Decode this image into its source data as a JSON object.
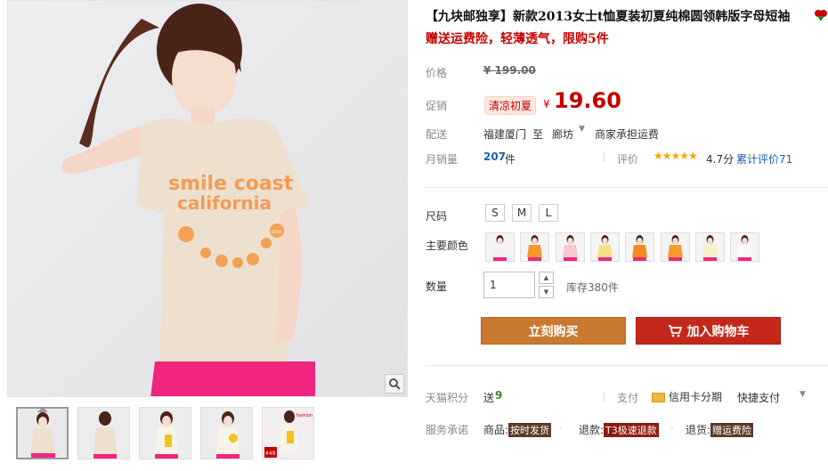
{
  "product": {
    "title": "【九块邮独享】新款2013女士t恤夏装初夏纯棉圆领韩版字母短袖",
    "subtitle": "赠送运费险，轻薄透气，限购5件",
    "shirt_text_1": "smile coast",
    "shirt_text_2": "california",
    "shirt_badge": "one"
  },
  "price": {
    "label": "价格",
    "original": "¥ 199.00"
  },
  "promo": {
    "label": "促销",
    "badge": "清凉初夏",
    "symbol": "¥",
    "price": "19.60"
  },
  "delivery": {
    "label": "配送",
    "from": "福建厦门",
    "to_word": "至",
    "to": "廊坊",
    "fee": "商家承担运费"
  },
  "sales": {
    "label": "月销量",
    "count": "207",
    "unit": "件",
    "rating_label": "评价",
    "stars": "★★★★★",
    "score": "4.7分",
    "reviews": "累计评价71"
  },
  "size": {
    "label": "尺码",
    "options": [
      "S",
      "M",
      "L"
    ]
  },
  "color": {
    "label": "主要颜色",
    "swatches": [
      "#f2f2f2",
      "#f39a2a",
      "#f7c8cf",
      "#f5e08a",
      "#f58a1f",
      "#f59d2a",
      "#f5f0c8",
      "#fafafa"
    ]
  },
  "quantity": {
    "label": "数量",
    "value": "1",
    "stock": "库存380件"
  },
  "buttons": {
    "buy": "立刻购买",
    "cart": "加入购物车"
  },
  "points": {
    "label": "天猫积分",
    "prefix": "送",
    "value": "9",
    "pay_label": "支付",
    "credit": "信用卡分期",
    "quick": "快捷支付"
  },
  "service": {
    "label": "服务承诺",
    "goods": "商品:",
    "goods_tag": "按时发货",
    "refund": "退款:",
    "refund_tag": "T3极速退款",
    "return": "退货:",
    "return_tag": "赠运费险"
  },
  "thumbs": {
    "t5_price": "¥49",
    "t5_caption": "fashion"
  },
  "colors": {
    "accent_red": "#c40000",
    "buy_btn": "#c9792f",
    "cart_btn": "#c4281b",
    "link_blue": "#1a5fb4"
  }
}
